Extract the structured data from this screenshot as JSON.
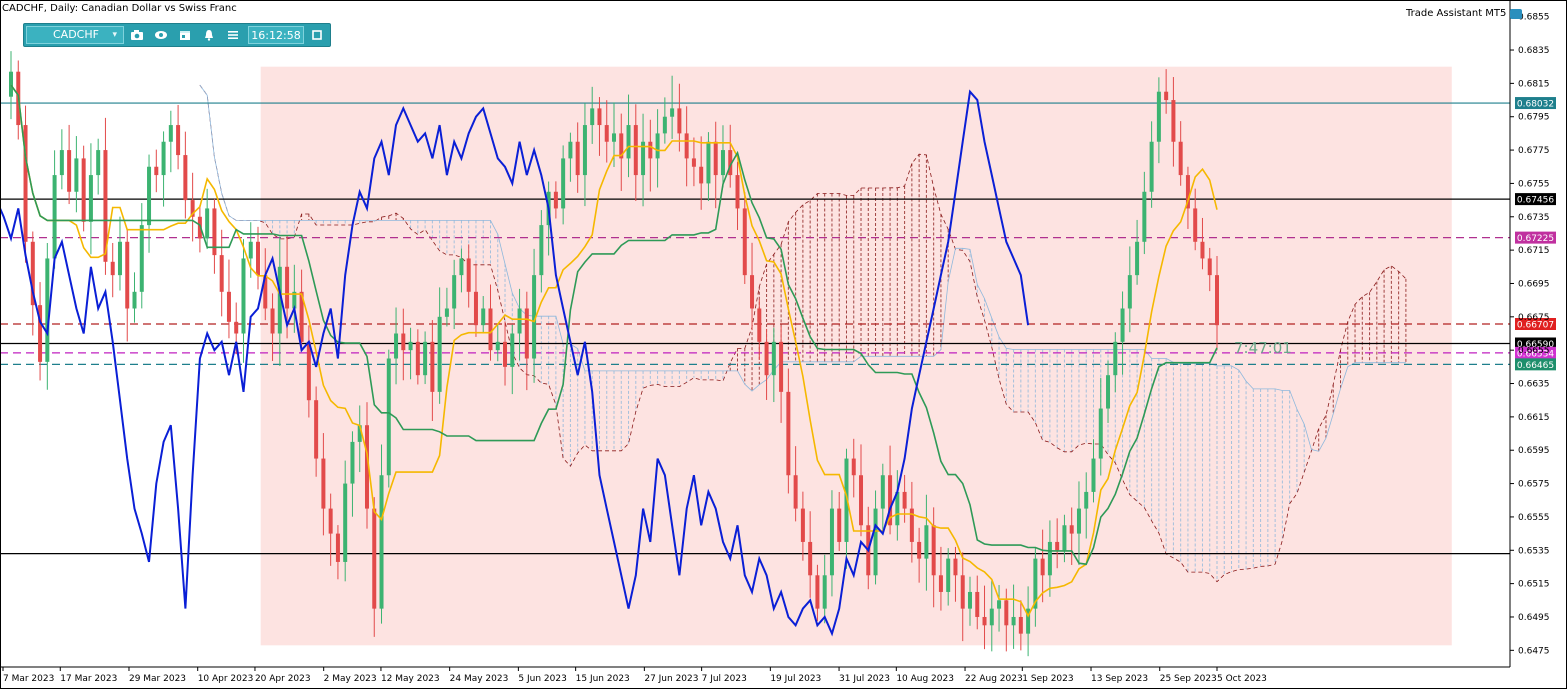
{
  "header": {
    "title": "CADCHF, Daily:  Canadian Dollar vs Swiss Franc",
    "assistant_label": "Trade Assistant MT5"
  },
  "toolbar": {
    "symbol": "CADCHF",
    "time": "16:12:58",
    "icons": [
      "camera-icon",
      "eye-icon",
      "calendar-icon",
      "alert-bell-icon",
      "menu-icon",
      "window-icon"
    ]
  },
  "countdown": "7:47:01",
  "colors": {
    "bull": "#3cb371",
    "bear": "#e24a4a",
    "tenkan": "#f5b800",
    "kijun": "#2e9a57",
    "chikou": "#0a1fd6",
    "zone": "#fde3e1",
    "senkou_a": "#8a1a1a",
    "senkou_b": "#8fb8dc"
  },
  "chart_data": {
    "type": "candlestick",
    "timeframe": "Daily",
    "symbol": "CADCHF",
    "ylim": [
      0.6465,
      0.6865
    ],
    "y_ticks": [
      0.6855,
      0.6835,
      0.6815,
      0.6795,
      0.6775,
      0.6755,
      0.6735,
      0.6715,
      0.6695,
      0.6675,
      0.6655,
      0.6635,
      0.6615,
      0.6595,
      0.6575,
      0.6555,
      0.6535,
      0.6515,
      0.6495,
      0.6475
    ],
    "x_labels": [
      {
        "label": "7 Mar 2023",
        "date": "2023-03-07"
      },
      {
        "label": "17 Mar 2023",
        "date": "2023-03-17"
      },
      {
        "label": "29 Mar 2023",
        "date": "2023-03-29"
      },
      {
        "label": "10 Apr 2023",
        "date": "2023-04-10"
      },
      {
        "label": "20 Apr 2023",
        "date": "2023-04-20"
      },
      {
        "label": "2 May 2023",
        "date": "2023-05-02"
      },
      {
        "label": "12 May 2023",
        "date": "2023-05-12"
      },
      {
        "label": "24 May 2023",
        "date": "2023-05-24"
      },
      {
        "label": "5 Jun 2023",
        "date": "2023-06-05"
      },
      {
        "label": "15 Jun 2023",
        "date": "2023-06-15"
      },
      {
        "label": "27 Jun 2023",
        "date": "2023-06-27"
      },
      {
        "label": "7 Jul 2023",
        "date": "2023-07-07"
      },
      {
        "label": "19 Jul 2023",
        "date": "2023-07-19"
      },
      {
        "label": "31 Jul 2023",
        "date": "2023-07-31"
      },
      {
        "label": "10 Aug 2023",
        "date": "2023-08-10"
      },
      {
        "label": "22 Aug 2023",
        "date": "2023-08-22"
      },
      {
        "label": "1 Sep 2023",
        "date": "2023-09-01"
      },
      {
        "label": "13 Sep 2023",
        "date": "2023-09-13"
      },
      {
        "label": "25 Sep 2023",
        "date": "2023-09-25"
      },
      {
        "label": "5 Oct 2023",
        "date": "2023-10-05"
      }
    ],
    "closes": [
      0.6822,
      0.679,
      0.672,
      0.6682,
      0.6648,
      0.671,
      0.676,
      0.6775,
      0.675,
      0.677,
      0.6732,
      0.676,
      0.6775,
      0.6708,
      0.67,
      0.672,
      0.668,
      0.669,
      0.673,
      0.6765,
      0.676,
      0.678,
      0.679,
      0.6772,
      0.6745,
      0.6735,
      0.6722,
      0.674,
      0.6712,
      0.669,
      0.6672,
      0.6665,
      0.671,
      0.672,
      0.67,
      0.668,
      0.6665,
      0.6705,
      0.668,
      0.669,
      0.666,
      0.6625,
      0.659,
      0.656,
      0.6545,
      0.6528,
      0.6575,
      0.66,
      0.661,
      0.656,
      0.65,
      0.658,
      0.665,
      0.6665,
      0.6655,
      0.666,
      0.664,
      0.666,
      0.663,
      0.6675,
      0.668,
      0.67,
      0.671,
      0.669,
      0.667,
      0.668,
      0.6655,
      0.666,
      0.6645,
      0.6665,
      0.668,
      0.665,
      0.67,
      0.673,
      0.675,
      0.674,
      0.677,
      0.678,
      0.676,
      0.679,
      0.68,
      0.679,
      0.678,
      0.6785,
      0.677,
      0.679,
      0.676,
      0.678,
      0.677,
      0.6785,
      0.6795,
      0.68,
      0.6785,
      0.677,
      0.6765,
      0.6755,
      0.678,
      0.676,
      0.6775,
      0.676,
      0.674,
      0.67,
      0.668,
      0.666,
      0.664,
      0.666,
      0.663,
      0.658,
      0.656,
      0.654,
      0.652,
      0.65,
      0.652,
      0.656,
      0.654,
      0.659,
      0.658,
      0.655,
      0.652,
      0.656,
      0.658,
      0.655,
      0.657,
      0.656,
      0.654,
      0.653,
      0.655,
      0.652,
      0.651,
      0.653,
      0.652,
      0.65,
      0.651,
      0.6495,
      0.649,
      0.65,
      0.6505,
      0.649,
      0.6495,
      0.6485,
      0.65,
      0.653,
      0.652,
      0.654,
      0.6535,
      0.655,
      0.6545,
      0.656,
      0.657,
      0.659,
      0.662,
      0.664,
      0.666,
      0.668,
      0.67,
      0.672,
      0.675,
      0.678,
      0.681,
      0.6805,
      0.678,
      0.676,
      0.674,
      0.672,
      0.671,
      0.67,
      0.667
    ],
    "series": [
      {
        "name": "Candles",
        "kind": "ohlc"
      },
      {
        "name": "Tenkan-sen",
        "kind": "line"
      },
      {
        "name": "Kijun-sen",
        "kind": "line"
      },
      {
        "name": "Chikou Span",
        "kind": "line"
      },
      {
        "name": "Senkou Span A",
        "kind": "cloud"
      },
      {
        "name": "Senkou Span B",
        "kind": "cloud"
      }
    ],
    "zone": {
      "x_from": "2023-04-21",
      "x_to": "2023-11-15",
      "y_from": 0.6478,
      "y_to": 0.6825
    },
    "levels": [
      {
        "value": 0.68032,
        "label": "0.68032",
        "style": "solid",
        "color": "#1e7f8c",
        "tag_color": "#1e7f8c"
      },
      {
        "value": 0.67456,
        "label": "0.67456",
        "style": "solid",
        "color": "#000000",
        "tag_color": "#000000"
      },
      {
        "value": 0.67225,
        "label": "0.67225",
        "style": "dashed",
        "color": "#b0308f",
        "tag_color": "#c0309f"
      },
      {
        "value": 0.66707,
        "label": "0.66707",
        "style": "dashed",
        "color": "#b22222",
        "tag_color": "#e02020"
      },
      {
        "value": 0.6659,
        "label": "0.66590",
        "style": "solid",
        "color": "#000000",
        "tag_color": "#000000"
      },
      {
        "value": 0.66534,
        "label": "0.66534",
        "style": "dashed",
        "color": "#c020c0",
        "tag_color": "#d030d0"
      },
      {
        "value": 0.66465,
        "label": "0.66465",
        "style": "dashed",
        "color": "#1e7f8c",
        "tag_color": "#1e8f6c"
      },
      {
        "value": 0.6533,
        "label": "",
        "style": "solid",
        "color": "#000000",
        "tag_color": ""
      }
    ]
  }
}
